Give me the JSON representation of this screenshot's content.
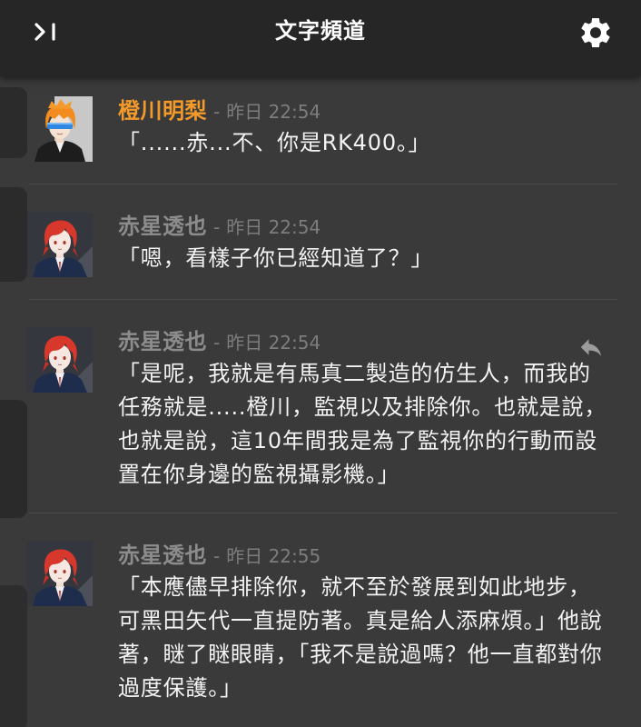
{
  "header": {
    "title": "文字頻道",
    "left_icon": "collapse-sidebar-icon",
    "right_icon": "gear-icon"
  },
  "messages": [
    {
      "avatar": "orange-hair-character-avatar",
      "author": "橙川明梨",
      "author_color": "#f39a2a",
      "dash": "-",
      "timestamp": "昨日 22:54",
      "lines": [
        "「......赤...不、你是RK400。」"
      ]
    },
    {
      "avatar": "red-hair-character-avatar",
      "author": "赤星透也",
      "author_color": "#8c8c8c",
      "dash": "-",
      "timestamp": "昨日 22:54",
      "lines": [
        "「嗯，看樣子你已經知道了？」"
      ]
    },
    {
      "avatar": "red-hair-character-avatar",
      "author": "赤星透也",
      "author_color": "#8c8c8c",
      "dash": "-",
      "timestamp": "昨日 22:54",
      "action_icon": "reply-icon",
      "lines": [
        "「是呢，我就是有馬真二製造的仿生人，而我的",
        "任務就是.....橙川，監視以及排除你。也就是說，",
        "也就是說，這10年間我是為了監視你的行動而設",
        "置在你身邊的監視攝影機。」"
      ]
    },
    {
      "avatar": "red-hair-character-avatar",
      "author": "赤星透也",
      "author_color": "#8c8c8c",
      "dash": "-",
      "timestamp": "昨日 22:55",
      "lines": [
        "「本應儘早排除你，就不至於發展到如此地步，",
        "可黑田矢代一直提防著。真是給人添麻煩。」他說",
        "著，瞇了瞇眼睛，「我不是說過嗎？他一直都對你",
        "過度保護。」"
      ]
    }
  ]
}
